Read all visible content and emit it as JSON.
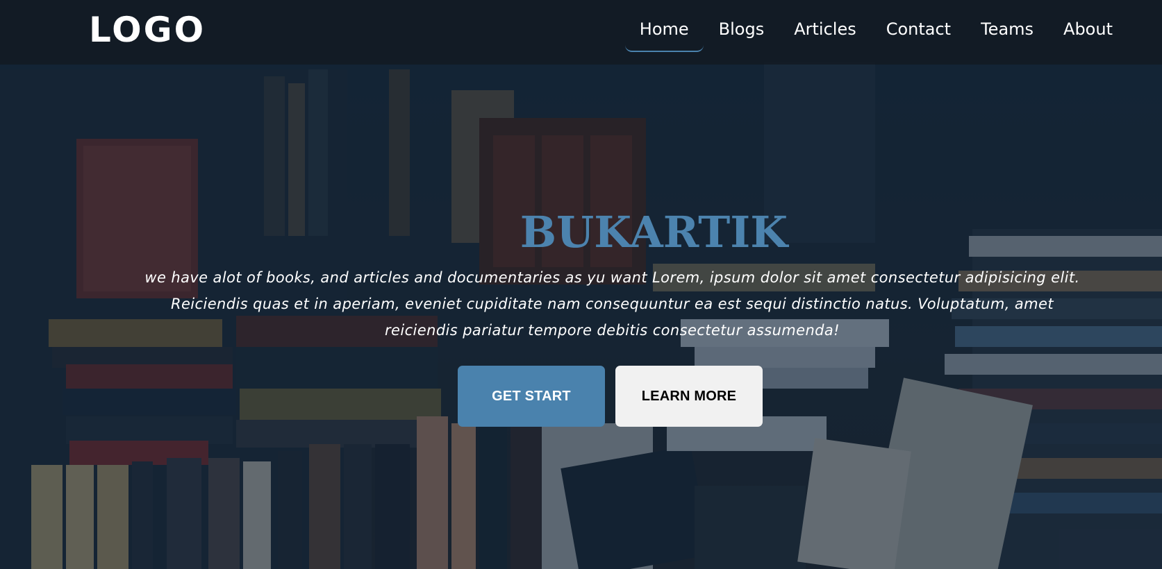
{
  "header": {
    "logo_text": "LOGO",
    "nav": [
      {
        "label": "Home",
        "active": true
      },
      {
        "label": "Blogs",
        "active": false
      },
      {
        "label": "Articles",
        "active": false
      },
      {
        "label": "Contact",
        "active": false
      },
      {
        "label": "Teams",
        "active": false
      },
      {
        "label": "About",
        "active": false
      }
    ]
  },
  "hero": {
    "title": "BUKARTIK",
    "description": "we have alot of books, and articles and documentaries as yu want Lorem, ipsum dolor sit amet consectetur adipisicing elit. Reiciendis quas et in aperiam, eveniet cupiditate nam consequuntur ea est sequi distinctio natus. Voluptatum, amet reiciendis pariatur tempore debitis consectetur assumenda!",
    "primary_button": "GET START",
    "secondary_button": "LEARN MORE",
    "background": "bookshelf-photo"
  },
  "colors": {
    "accent": "#4a82ad",
    "title": "#4c83ae",
    "navbar": "#121a22",
    "secondary_button": "#f1f1f1"
  }
}
